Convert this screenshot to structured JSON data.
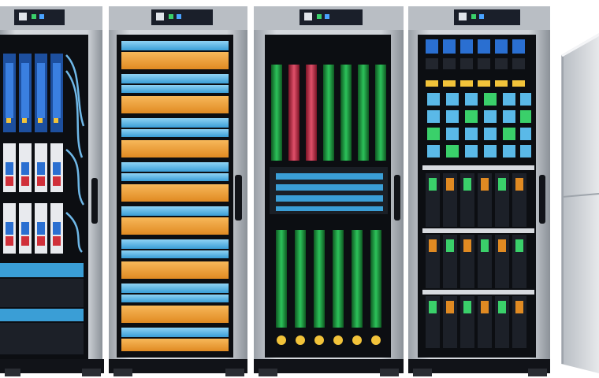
{
  "scene": {
    "subject": "server-racks",
    "colors": {
      "background": "#ffffff",
      "frame": "#c9cdd2",
      "frame_dark": "#8e949b",
      "interior": "#0c0e12",
      "orange_drive": "#f2a43a",
      "blue_drive": "#5ab9e8",
      "green_board": "#1e8f3a",
      "red_board": "#c8304a",
      "blue_board": "#2a6fd1",
      "display": "#1a1f2a"
    },
    "racks": [
      {
        "name": "rack-left-partial",
        "style": "blade-servers-with-cables"
      },
      {
        "name": "rack-orange-blue-drives",
        "style": "alternating-drive-bays"
      },
      {
        "name": "rack-green-boards",
        "style": "vertical-circuit-boards"
      },
      {
        "name": "rack-blue-modules",
        "style": "module-grid-and-drive-cages"
      },
      {
        "name": "rack-right-cabinet",
        "style": "closed-door-cabinet"
      }
    ]
  }
}
